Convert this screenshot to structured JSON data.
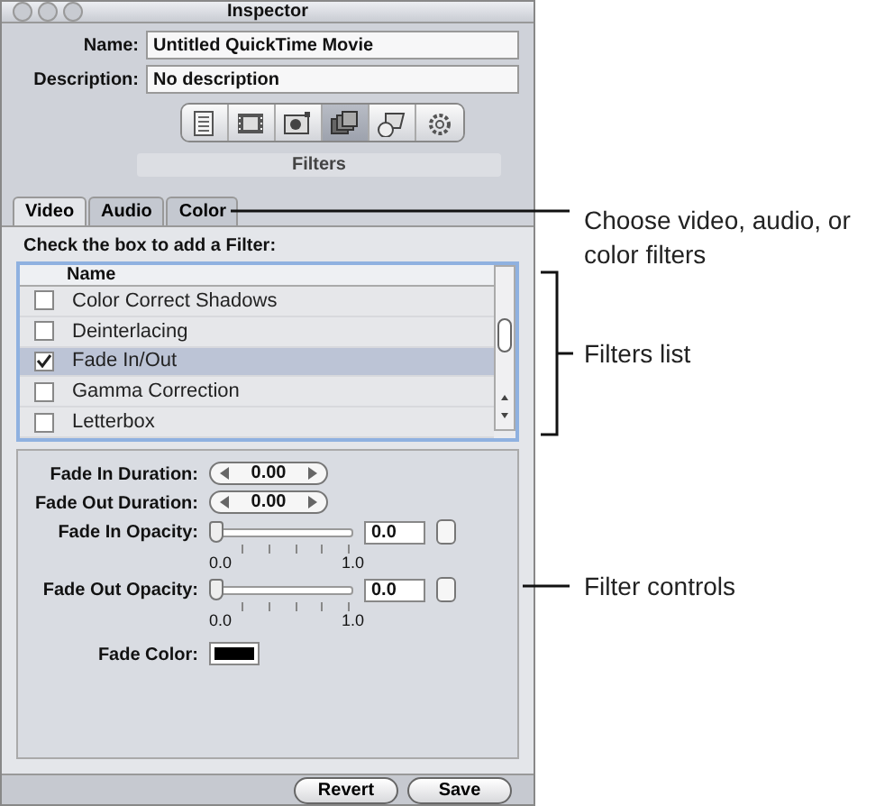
{
  "window": {
    "title": "Inspector"
  },
  "fields": [
    {
      "label": "Name:",
      "value": "Untitled QuickTime Movie"
    },
    {
      "label": "Description:",
      "value": "No description"
    }
  ],
  "toolbar": {
    "buttons": [
      {
        "selected": false
      },
      {
        "selected": false
      },
      {
        "selected": false
      },
      {
        "selected": true
      },
      {
        "selected": false
      },
      {
        "selected": false
      }
    ],
    "label": "Filters"
  },
  "tabs": [
    {
      "label": "Video",
      "selected": true
    },
    {
      "label": "Audio",
      "selected": false
    },
    {
      "label": "Color",
      "selected": false
    }
  ],
  "filter_list": {
    "prompt": "Check the box to add a Filter:",
    "column": "Name",
    "rows": [
      {
        "name": "Color Correct Shadows",
        "checked": false,
        "selected": false
      },
      {
        "name": "Deinterlacing",
        "checked": false,
        "selected": false
      },
      {
        "name": "Fade In/Out",
        "checked": true,
        "selected": true
      },
      {
        "name": "Gamma Correction",
        "checked": false,
        "selected": false
      },
      {
        "name": "Letterbox",
        "checked": false,
        "selected": false
      }
    ]
  },
  "controls": [
    {
      "kind": "stepper",
      "label": "Fade In Duration:",
      "value": "0.00"
    },
    {
      "kind": "stepper",
      "label": "Fade Out Duration:",
      "value": "0.00"
    },
    {
      "kind": "slider",
      "label": "Fade In Opacity:",
      "level": 0,
      "value": "0.0",
      "min_label": "0.0",
      "max_label": "1.0"
    },
    {
      "kind": "slider",
      "label": "Fade Out Opacity:",
      "level": 0,
      "value": "0.0",
      "min_label": "0.0",
      "max_label": "1.0"
    },
    {
      "kind": "color",
      "label": "Fade Color:",
      "color": "#000000"
    }
  ],
  "buttons": [
    {
      "label": "Revert"
    },
    {
      "label": "Save"
    }
  ],
  "callouts": [
    {
      "kind": "line",
      "text": "Choose video, audio, or color filters"
    },
    {
      "kind": "bracket",
      "text": "Filters list"
    },
    {
      "kind": "line",
      "text": "Filter controls"
    }
  ]
}
